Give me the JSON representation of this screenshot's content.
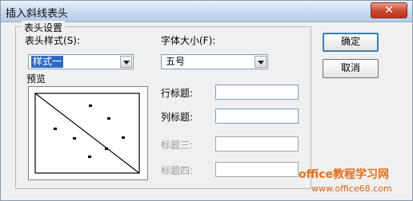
{
  "window": {
    "title": "插入斜线表头",
    "close_glyph": "✕"
  },
  "group": {
    "legend": "表头设置"
  },
  "style_field": {
    "label": "表头样式(S):",
    "value": "样式一"
  },
  "font_field": {
    "label": "字体大小(F):",
    "value": "五号"
  },
  "preview": {
    "label": "预览"
  },
  "row_title": {
    "label": "行标题:",
    "value": ""
  },
  "col_title": {
    "label": "列标题:",
    "value": ""
  },
  "title3": {
    "label": "标题三:",
    "value": ""
  },
  "title4": {
    "label": "标题四:",
    "value": ""
  },
  "buttons": {
    "ok": "确定",
    "cancel": "取消"
  },
  "watermark": {
    "line1": "office教程学习网",
    "line2": "www.office68.com"
  },
  "colors": {
    "accent": "#316ac5",
    "watermark": "#e0701d"
  }
}
